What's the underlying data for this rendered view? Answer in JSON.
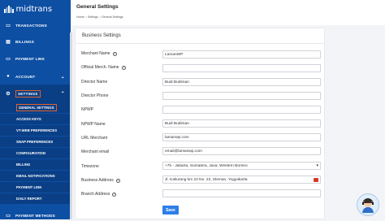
{
  "brand": {
    "name": "midtrans"
  },
  "sidebar": {
    "items": [
      {
        "label": "TRANSACTIONS",
        "icon": "card-icon"
      },
      {
        "label": "BILLINGS",
        "icon": "invoice-icon"
      },
      {
        "label": "PAYMENT LINK",
        "icon": "link-icon"
      },
      {
        "label": "ACCOUNT",
        "icon": "user-icon"
      },
      {
        "label": "SETTINGS",
        "icon": "gear-icon"
      }
    ],
    "settings_sub": [
      "GENERAL SETTINGS",
      "ACCESS KEYS",
      "VT-WEB PREFERENCES",
      "SNAP PREFERENCES",
      "CONFIGURATION",
      "BILLING",
      "EMAIL NOTIFICATIONS",
      "PAYMENT LINK",
      "DAILY REPORT"
    ],
    "bottom_item": "PAYMENT METHODS"
  },
  "header": {
    "title": "General Settings",
    "breadcrumb": [
      "Home",
      "Settings",
      "General Settings"
    ]
  },
  "form": {
    "title": "Business Settings",
    "fields": [
      {
        "label": "Merchant Name",
        "info": true,
        "value": "LamanWP"
      },
      {
        "label": "Official Merch. Name",
        "info": true,
        "value": ""
      },
      {
        "label": "Director Name",
        "info": false,
        "value": "Budi Budiman"
      },
      {
        "label": "Director Phone",
        "info": false,
        "value": ""
      },
      {
        "label": "NPWP",
        "info": false,
        "value": ""
      },
      {
        "label": "NPWP Name",
        "info": false,
        "value": "Budi Budiman"
      },
      {
        "label": "URL Merchant",
        "info": false,
        "value": "lamanwp.com"
      },
      {
        "label": "Merchant email",
        "info": false,
        "value": "email@lamanwp.com"
      },
      {
        "label": "Timezone",
        "info": false,
        "value": "+7h - Jakarta, Sumatera, Java, Western Borneo"
      },
      {
        "label": "Business Address",
        "info": true,
        "value": "Jl. Kaliurang km 10 No. 22, Sleman, Yogyakarta"
      },
      {
        "label": "Branch Address",
        "info": true,
        "value": ""
      }
    ],
    "save_label": "Save"
  }
}
